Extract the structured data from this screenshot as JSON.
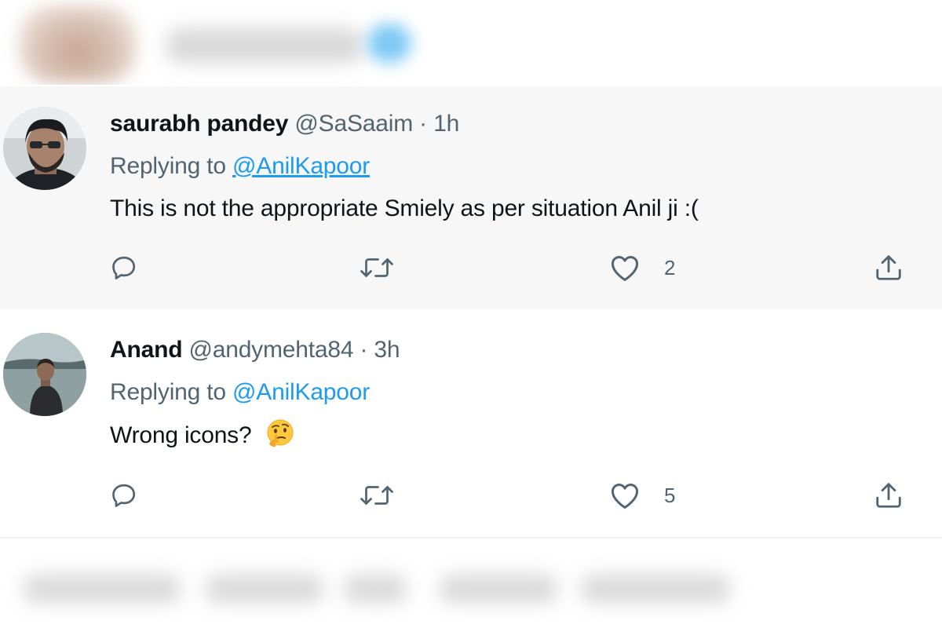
{
  "tweets": [
    {
      "display_name": "saurabh pandey",
      "handle": "@SaSaaim",
      "separator": "·",
      "time": "1h",
      "replying_prefix": "Replying to",
      "replying_to": "@AnilKapoor",
      "text": "This is not the appropriate Smiely as per situation Anil ji :(",
      "like_count": "2",
      "highlighted": true
    },
    {
      "display_name": "Anand",
      "handle": "@andymehta84",
      "separator": "·",
      "time": "3h",
      "replying_prefix": "Replying to",
      "replying_to": "@AnilKapoor",
      "text": "Wrong icons?",
      "emoji": "thinking-face",
      "like_count": "5",
      "highlighted": false
    }
  ],
  "colors": {
    "text_primary": "#0f1419",
    "text_secondary": "#536471",
    "link": "#1d9bf0",
    "highlight_bg": "#f7f7f7"
  },
  "icons": [
    "reply-icon",
    "retweet-icon",
    "like-icon",
    "share-icon"
  ]
}
